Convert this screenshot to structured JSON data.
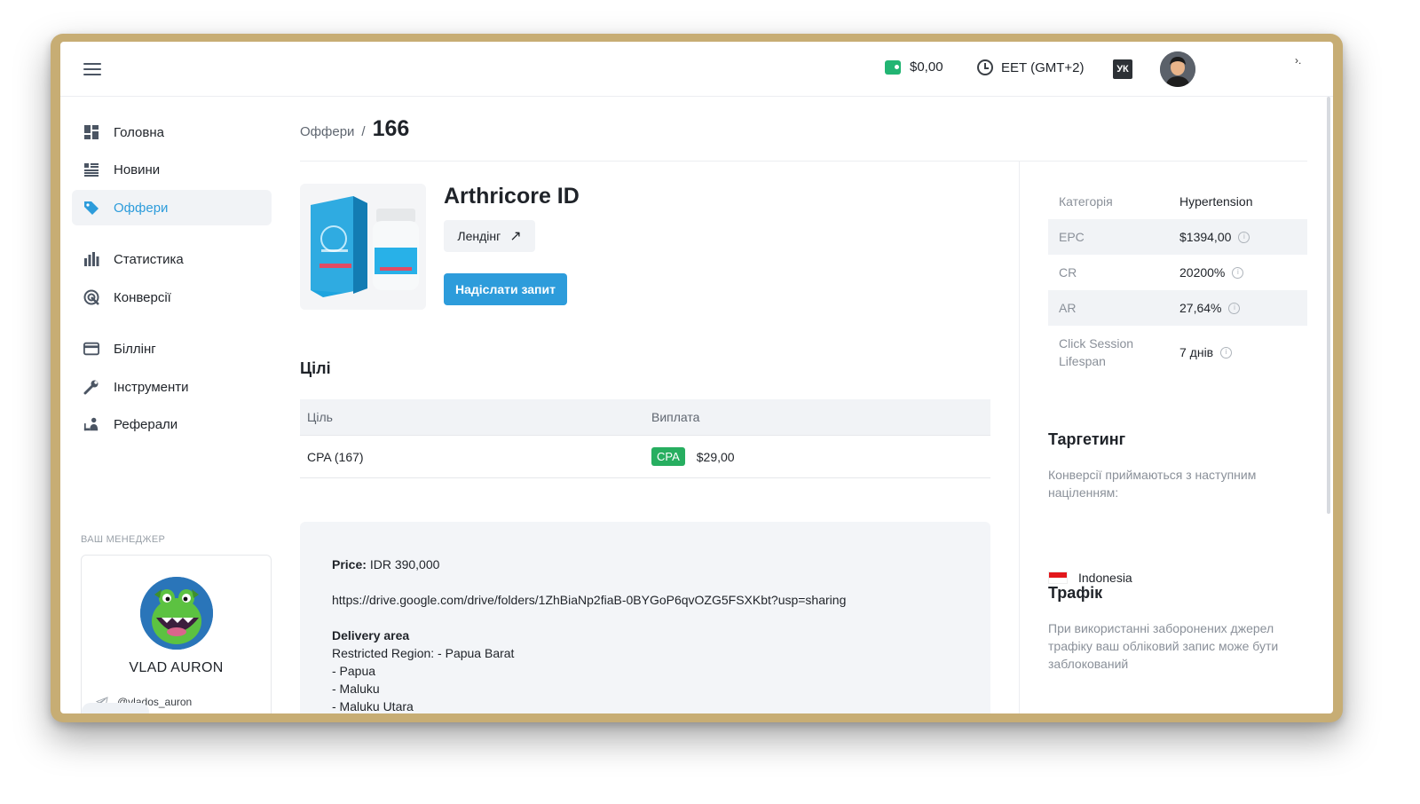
{
  "topbar": {
    "balance": "$0,00",
    "timezone": "EET (GMT+2)",
    "lang": "УК",
    "corner_glyph": "›."
  },
  "sidebar": {
    "items": [
      {
        "label": "Головна",
        "icon": "dashboard-icon"
      },
      {
        "label": "Новини",
        "icon": "news-icon"
      },
      {
        "label": "Оффери",
        "icon": "tag-icon",
        "active": true
      },
      {
        "label": "Статистика",
        "icon": "bar-chart-icon"
      },
      {
        "label": "Конверсії",
        "icon": "target-icon"
      },
      {
        "label": "Біллінг",
        "icon": "credit-card-icon"
      },
      {
        "label": "Інструменти",
        "icon": "wrench-icon"
      },
      {
        "label": "Реферали",
        "icon": "referral-icon"
      }
    ],
    "manager": {
      "title": "ВАШ МЕНЕДЖЕР",
      "name": "VLAD AURON",
      "handle": "@vlados_auron"
    }
  },
  "main": {
    "breadcrumb": {
      "parent": "Оффери",
      "sep": "/",
      "current": "166"
    },
    "offer": {
      "title": "Arthricore ID",
      "landing_label": "Лендінг",
      "request_label": "Надіслати запит"
    },
    "goals": {
      "title": "Цілі",
      "columns": [
        "Ціль",
        "Виплата"
      ],
      "rows": [
        {
          "goal": "CPA (167)",
          "badge": "CPA",
          "payout": "$29,00"
        }
      ]
    },
    "description": {
      "price_label": "Price:",
      "price_value": "IDR 390,000",
      "url": "https://drive.google.com/drive/folders/1ZhBiaNp2fiaB-0BYGoP6qvOZG5FSXKbt?usp=sharing",
      "delivery_title": "Delivery area",
      "delivery_lines": [
        "Restricted Region: - Papua Barat",
        "- Papua",
        "- Maluku",
        "- Maluku Utara"
      ]
    }
  },
  "details": {
    "rows": [
      {
        "key": "Категорія",
        "value": "Hypertension",
        "info": false
      },
      {
        "key": "EPC",
        "value": "$1394,00",
        "info": true
      },
      {
        "key": "CR",
        "value": "20200%",
        "info": true
      },
      {
        "key": "AR",
        "value": "27,64%",
        "info": true
      },
      {
        "key": "Click Session Lifespan",
        "value": "7 днів",
        "info": true
      }
    ],
    "targeting_title": "Таргетинг",
    "targeting_text": "Конверсії приймаються з наступним націленням:",
    "country": "Indonesia",
    "traffic_title": "Трафік",
    "traffic_text": "При використанні заборонених джерел трафіку ваш обліковий запис може бути заблокований"
  },
  "colors": {
    "accent": "#2d9cdb",
    "success": "#27ae60",
    "frame": "#c7ad74"
  }
}
